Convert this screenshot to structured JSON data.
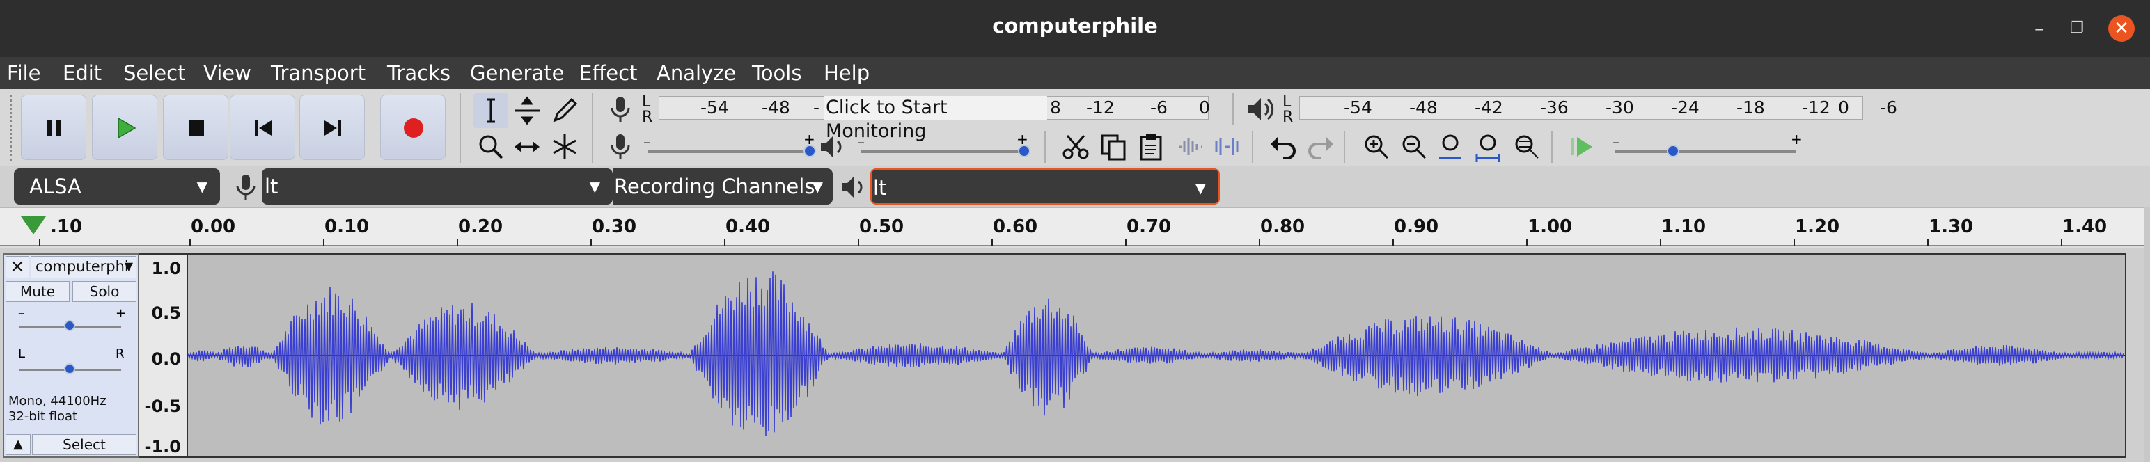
{
  "window": {
    "title": "computerphile",
    "minimize": "–",
    "maximize": "❐",
    "close": "✕"
  },
  "menu": [
    "File",
    "Edit",
    "Select",
    "View",
    "Transport",
    "Tracks",
    "Generate",
    "Effect",
    "Analyze",
    "Tools",
    "Help"
  ],
  "recording_meter": {
    "l": "L",
    "r": "R",
    "ticks": [
      "-54",
      "-48",
      "-"
    ],
    "prompt": "Click to Start Monitoring",
    "ticks_after": [
      "8",
      "-12",
      "-6",
      "0"
    ]
  },
  "playback_meter": {
    "l": "L",
    "r": "R",
    "ticks": [
      "-54",
      "-48",
      "-42",
      "-36",
      "-30",
      "-24",
      "-18",
      "-12",
      "-6",
      "0"
    ]
  },
  "sliders": {
    "minus": "–",
    "plus": "+"
  },
  "devices": {
    "host": "ALSA",
    "recording_device": "lt",
    "channels": "Recording Channels",
    "playback_device": "lt"
  },
  "timeline": {
    "labels": [
      ".10",
      "0.00",
      "0.10",
      "0.20",
      "0.30",
      "0.40",
      "0.50",
      "0.60",
      "0.70",
      "0.80",
      "0.90",
      "1.00",
      "1.10",
      "1.20",
      "1.30",
      "1.40"
    ]
  },
  "track": {
    "name": "computerphi",
    "close": "×",
    "mute": "Mute",
    "solo": "Solo",
    "gain_minus": "–",
    "gain_plus": "+",
    "pan_l": "L",
    "pan_r": "R",
    "info_line1": "Mono, 44100Hz",
    "info_line2": "32-bit float",
    "select": "Select",
    "collapse": "▲",
    "vruler": [
      "1.0",
      "0.5",
      "0.0",
      "-0.5",
      "-1.0"
    ],
    "wave_color": "#3a3fd1"
  }
}
